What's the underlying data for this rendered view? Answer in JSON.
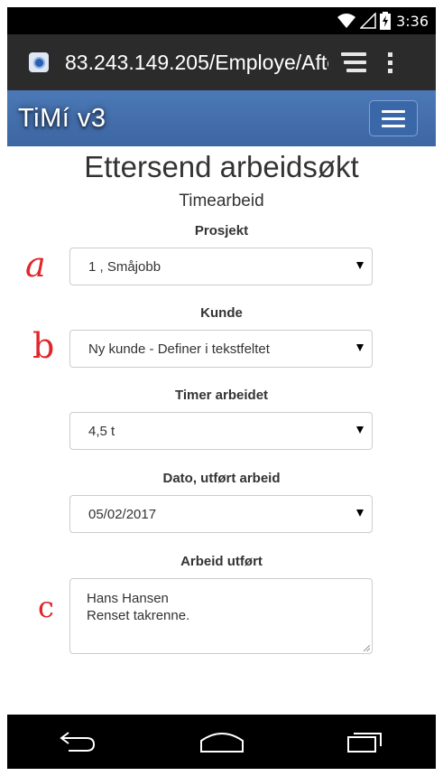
{
  "status_bar": {
    "time": "3:36"
  },
  "browser": {
    "url": "83.243.149.205/Employe/Afte"
  },
  "app": {
    "brand": "TiMí v3"
  },
  "page": {
    "title": "Ettersend arbeidsøkt",
    "subtitle": "Timearbeid"
  },
  "form": {
    "prosjekt": {
      "label": "Prosjekt",
      "value": "1 , Småjobb"
    },
    "kunde": {
      "label": "Kunde",
      "value": "Ny kunde - Definer i tekstfeltet"
    },
    "timer": {
      "label": "Timer arbeidet",
      "value": "4,5 t"
    },
    "dato": {
      "label": "Dato, utført arbeid",
      "value": "05/02/2017"
    },
    "arbeid": {
      "label": "Arbeid utført",
      "line1": "Hans Hansen",
      "line2": "Renset takrenne."
    }
  },
  "annotations": {
    "a": "a",
    "b": "b",
    "c": "c"
  },
  "colors": {
    "navbar": "#4b79b7",
    "annotation": "#e0252b",
    "status_bar": "#000000",
    "url_bar": "#2b2b2b"
  }
}
